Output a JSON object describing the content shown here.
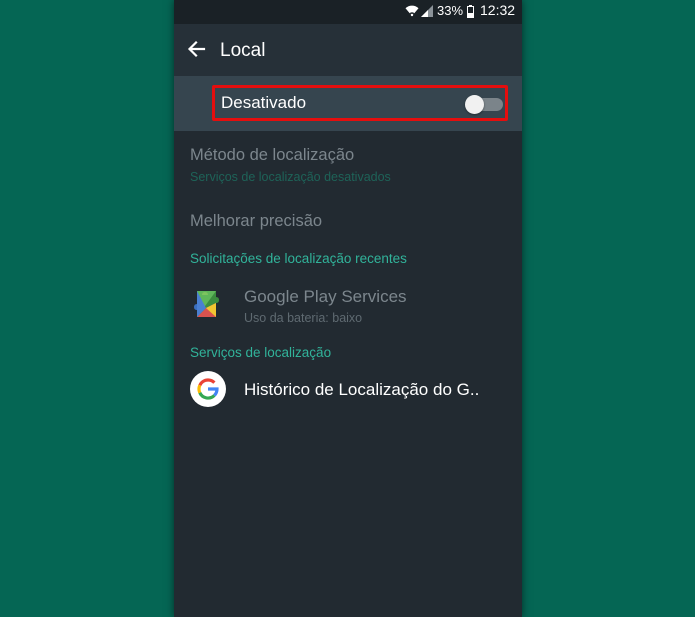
{
  "status_bar": {
    "battery": "33%",
    "time": "12:32"
  },
  "app_bar": {
    "title": "Local"
  },
  "master_switch": {
    "label": "Desativado",
    "checked": false
  },
  "settings": {
    "method_title": "Método de localização",
    "method_subtitle": "Serviços de localização desativados",
    "improve_title": "Melhorar precisão"
  },
  "recent_requests": {
    "header": "Solicitações de localização recentes",
    "items": [
      {
        "icon": "google-play-services-icon",
        "title": "Google Play Services",
        "subtitle": "Uso da bateria: baixo"
      }
    ]
  },
  "location_services": {
    "header": "Serviços de localização",
    "items": [
      {
        "icon": "google-g-icon",
        "title": "Histórico de Localização do G.."
      }
    ]
  },
  "colors": {
    "accent": "#31b39a",
    "highlight_box": "#e50e0e",
    "backdrop": "#056654",
    "screen": "#222a31"
  }
}
